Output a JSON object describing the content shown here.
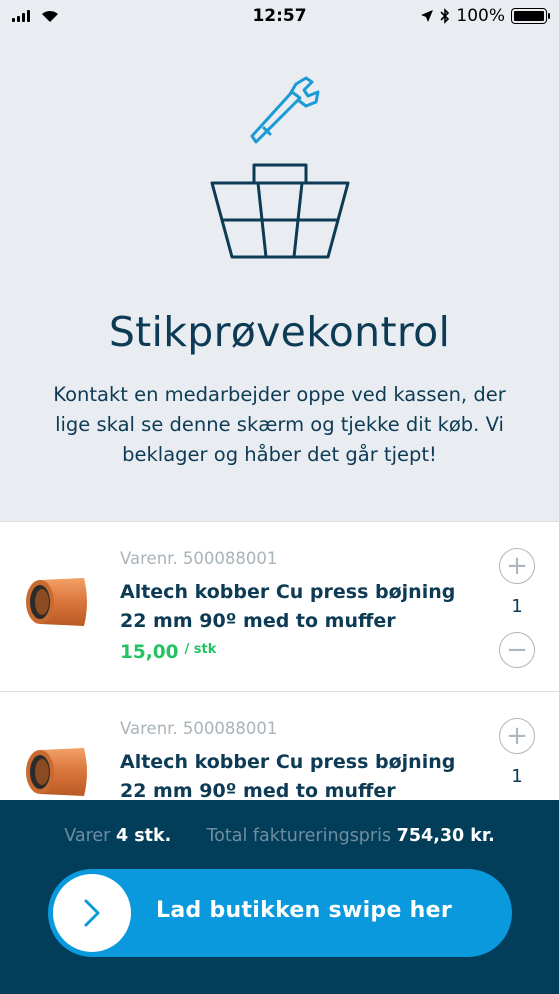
{
  "status_bar": {
    "time": "12:57",
    "battery": "100%"
  },
  "hero": {
    "title": "Stikprøvekontrol",
    "description": "Kontakt en medarbejder oppe ved kassen, der lige skal se denne skærm og tjekke dit køb. Vi beklager og håber det går tjept!"
  },
  "items": [
    {
      "varenr": "Varenr. 500088001",
      "name": "Altech kobber Cu press bøjning 22 mm 90º med to muffer",
      "price": "15,00",
      "unit": "/ stk",
      "quantity": "1"
    },
    {
      "varenr": "Varenr. 500088001",
      "name": "Altech kobber Cu press bøjning 22 mm 90º med to muffer",
      "price": "",
      "unit": "",
      "quantity": "1"
    }
  ],
  "summary": {
    "items_label": "Varer",
    "items_value": "4 stk.",
    "total_label": "Total faktureringspris",
    "total_value": "754,30 kr."
  },
  "swipe": {
    "label": "Lad butikken swipe her"
  },
  "colors": {
    "navy": "#023d59",
    "accent": "#0a99dd",
    "price_green": "#25c262",
    "text": "#0d3b55"
  }
}
